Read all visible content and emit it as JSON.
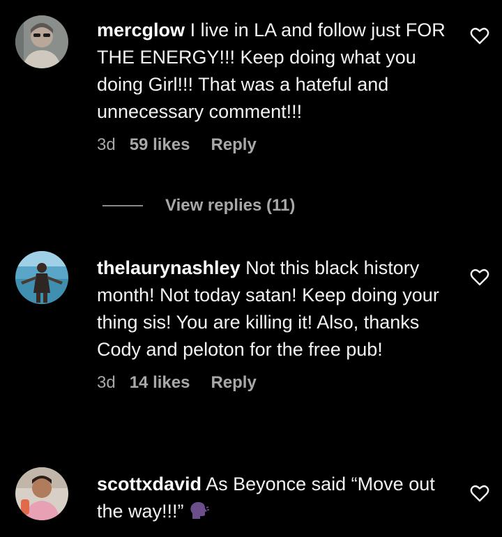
{
  "comments": [
    {
      "username": "mercglow",
      "text": "I live in LA and follow just FOR THE ENERGY!!! Keep doing what you doing Girl!!! That was a hateful and unnecessary comment!!!",
      "age": "3d",
      "likes": "59 likes",
      "reply": "Reply",
      "heart_icon": "heart-outline-icon"
    },
    {
      "username": "thelaurynashley",
      "text": "Not this black history month! Not today satan! Keep doing your thing sis! You are killing it! Also, thanks Cody and peloton for the free pub!",
      "age": "3d",
      "likes": "14 likes",
      "reply": "Reply",
      "heart_icon": "heart-outline-icon"
    },
    {
      "username": "scottxdavid",
      "text": "As Beyonce said “Move out the way!!!”",
      "emoji": "speaking-head-emoji",
      "heart_icon": "heart-outline-icon"
    }
  ],
  "view_replies": {
    "label": "View replies (11)"
  },
  "colors": {
    "background": "#000000",
    "text": "#f2f2f2",
    "secondary": "#a8a8a8"
  }
}
